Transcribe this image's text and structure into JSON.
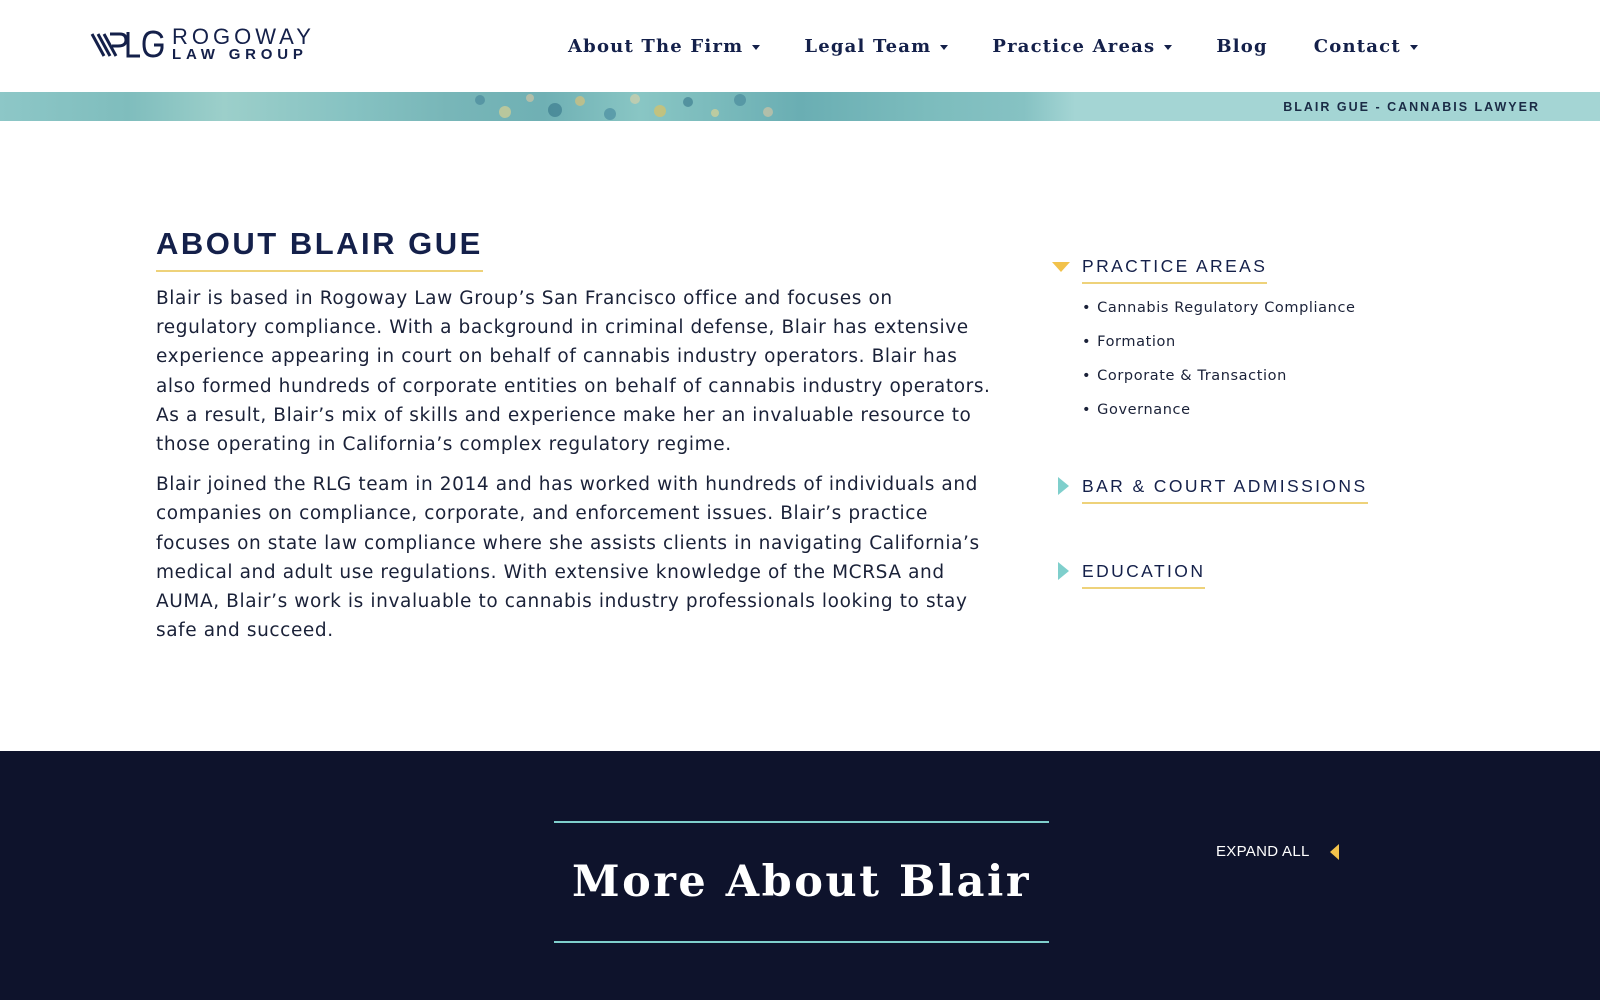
{
  "header": {
    "logo": {
      "mark_text": "RLG",
      "name": "ROGOWAY",
      "sub": "LAW GROUP"
    },
    "nav": {
      "about": "About The Firm",
      "legal": "Legal Team",
      "practice": "Practice Areas",
      "blog": "Blog",
      "contact": "Contact"
    }
  },
  "banner": {
    "label": "BLAIR GUE - CANNABIS LAWYER"
  },
  "about": {
    "title": "ABOUT BLAIR GUE",
    "paragraphs": [
      "Blair is based in Rogoway Law Group’s San Francisco office and focuses on regulatory compliance. With a background in criminal defense, Blair has extensive experience appearing in court on behalf of cannabis industry operators. Blair has also formed hundreds of corporate entities on behalf of cannabis industry operators. As a result, Blair’s mix of skills and experience make her an invaluable resource to those operating in California’s complex regulatory regime.",
      "Blair joined the RLG team in 2014 and has worked with hundreds of individuals and companies on compliance, corporate, and enforcement issues. Blair’s practice focuses on state law compliance where she assists clients in navigating California’s medical and adult use regulations. With extensive knowledge of the MCRSA and AUMA, Blair’s work is invaluable to cannabis industry professionals looking to stay safe and succeed."
    ]
  },
  "sidebar": {
    "practice_areas": {
      "title": "PRACTICE AREAS",
      "expanded": true,
      "items": [
        "Cannabis Regulatory Compliance",
        "Formation",
        "Corporate & Transaction",
        "Governance"
      ]
    },
    "bar_admissions": {
      "title": "BAR & COURT ADMISSIONS",
      "expanded": false
    },
    "education": {
      "title": "EDUCATION",
      "expanded": false
    },
    "bullet": "•"
  },
  "more": {
    "title": "More About Blair",
    "expand_all": "EXPAND ALL"
  },
  "colors": {
    "navy": "#14204a",
    "dark_section": "#0e132c",
    "gold_accent": "#eed27a",
    "arrow_gold": "#f2c24b",
    "teal_accent": "#7fcfcc",
    "banner_teal": "#a4d5d4"
  },
  "icons": {
    "nav_caret": "caret-down-icon",
    "expanded_arrow": "triangle-down-icon",
    "collapsed_arrow": "triangle-right-icon",
    "expand_all_arrow": "triangle-left-icon"
  }
}
